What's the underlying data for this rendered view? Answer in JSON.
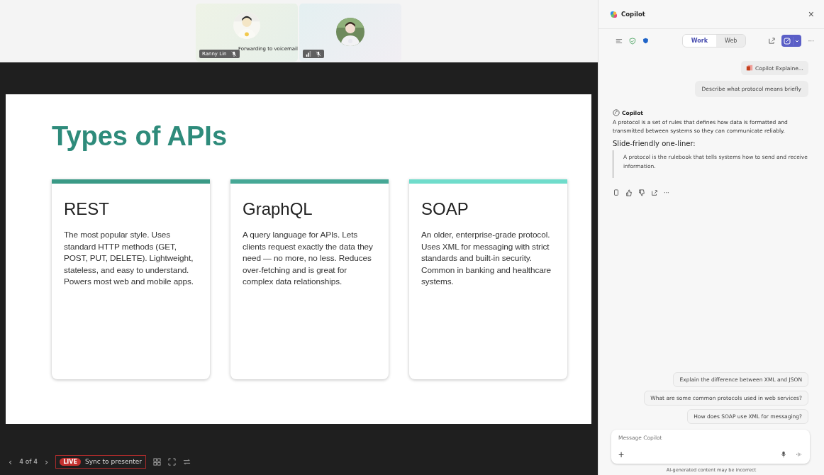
{
  "participants": [
    {
      "name": "Ranny Lin",
      "status": "Forwarding to voicemail",
      "muted": true
    },
    {
      "muted": true
    }
  ],
  "slide": {
    "title": "Types of APIs",
    "cards": [
      {
        "heading": "REST",
        "color": "#3a9a86",
        "body": "The most popular style. Uses standard HTTP methods (GET, POST, PUT, DELETE). Lightweight, stateless, and easy to understand. Powers most web and mobile apps."
      },
      {
        "heading": "GraphQL",
        "color": "#46a896",
        "body": "A query language for APIs. Lets clients request exactly the data they need — no more, no less. Reduces over-fetching and is great for complex data relationships."
      },
      {
        "heading": "SOAP",
        "color": "#6fdccb",
        "body": "An older, enterprise-grade protocol. Uses XML for messaging with strict standards and built-in security. Common in banking and healthcare systems."
      }
    ]
  },
  "presenter_bar": {
    "prev": "‹",
    "page": "4 of 4",
    "next": "›",
    "live_badge": "LIVE",
    "sync": "Sync to presenter"
  },
  "copilot": {
    "title": "Copilot",
    "close": "×",
    "modes": [
      {
        "label": "Work",
        "selected": true
      },
      {
        "label": "Web",
        "selected": false
      }
    ],
    "more": "···",
    "attachment": "Copilot Explaine...",
    "user_message": "Describe what protocol means briefly",
    "reply": {
      "author": "Copilot",
      "text": "A protocol is a set of rules that defines how data is formatted and transmitted between systems so they can communicate reliably.",
      "heading": "Slide-friendly one-liner:",
      "quote": "A protocol is the rulebook that tells systems how to send and receive information."
    },
    "reply_more": "···",
    "suggestions": [
      "Explain the difference between XML and JSON",
      "What are some common protocols used in web services?",
      "How does SOAP use XML for messaging?"
    ],
    "input": {
      "placeholder": "Message Copilot",
      "add": "+"
    },
    "disclaimer": "AI-generated content may be incorrect"
  }
}
